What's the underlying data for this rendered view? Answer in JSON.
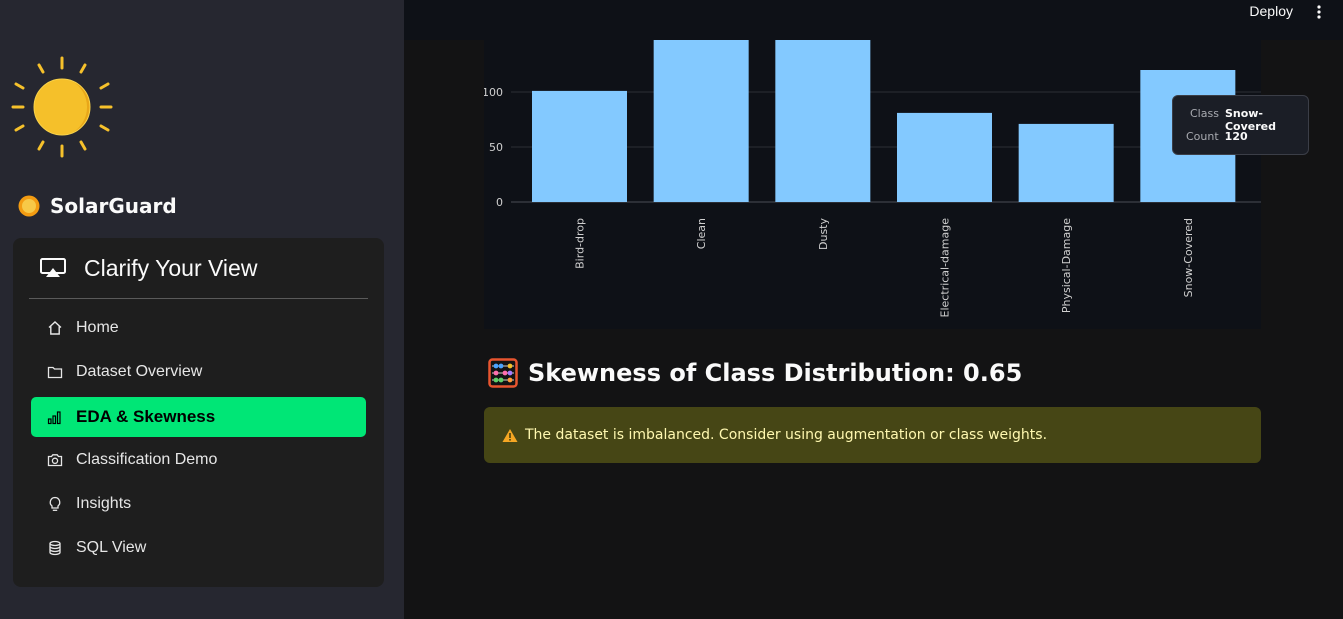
{
  "sidebar": {
    "brand": "SolarGuard",
    "nav_title": "Clarify Your View",
    "items": [
      {
        "label": "Home",
        "icon": "home-icon"
      },
      {
        "label": "Dataset Overview",
        "icon": "folder-icon"
      },
      {
        "label": "EDA & Skewness",
        "icon": "bar-chart-icon",
        "active": true
      },
      {
        "label": "Classification Demo",
        "icon": "camera-icon"
      },
      {
        "label": "Insights",
        "icon": "lightbulb-icon"
      },
      {
        "label": "SQL View",
        "icon": "database-icon"
      }
    ],
    "active_color": "#00e676"
  },
  "header": {
    "deploy_label": "Deploy"
  },
  "chart_data": {
    "type": "bar",
    "categories": [
      "Bird-drop",
      "Clean",
      "Dusty",
      "Electrical-damage",
      "Physical-Damage",
      "Snow-Covered"
    ],
    "values": [
      101,
      150,
      150,
      81,
      71,
      120
    ],
    "ylim": [
      0,
      115
    ],
    "yticks": [
      0,
      50,
      100
    ],
    "bar_color": "#83c9ff",
    "grid": true,
    "tooltip": {
      "class_label": "Class",
      "class_value": "Snow-Covered",
      "count_label": "Count",
      "count_value": "120"
    }
  },
  "main": {
    "skew_heading": "Skewness of Class Distribution: 0.65",
    "alert_text": "The dataset is imbalanced. Consider using augmentation or class weights.",
    "alert_icon": "warning-icon"
  }
}
